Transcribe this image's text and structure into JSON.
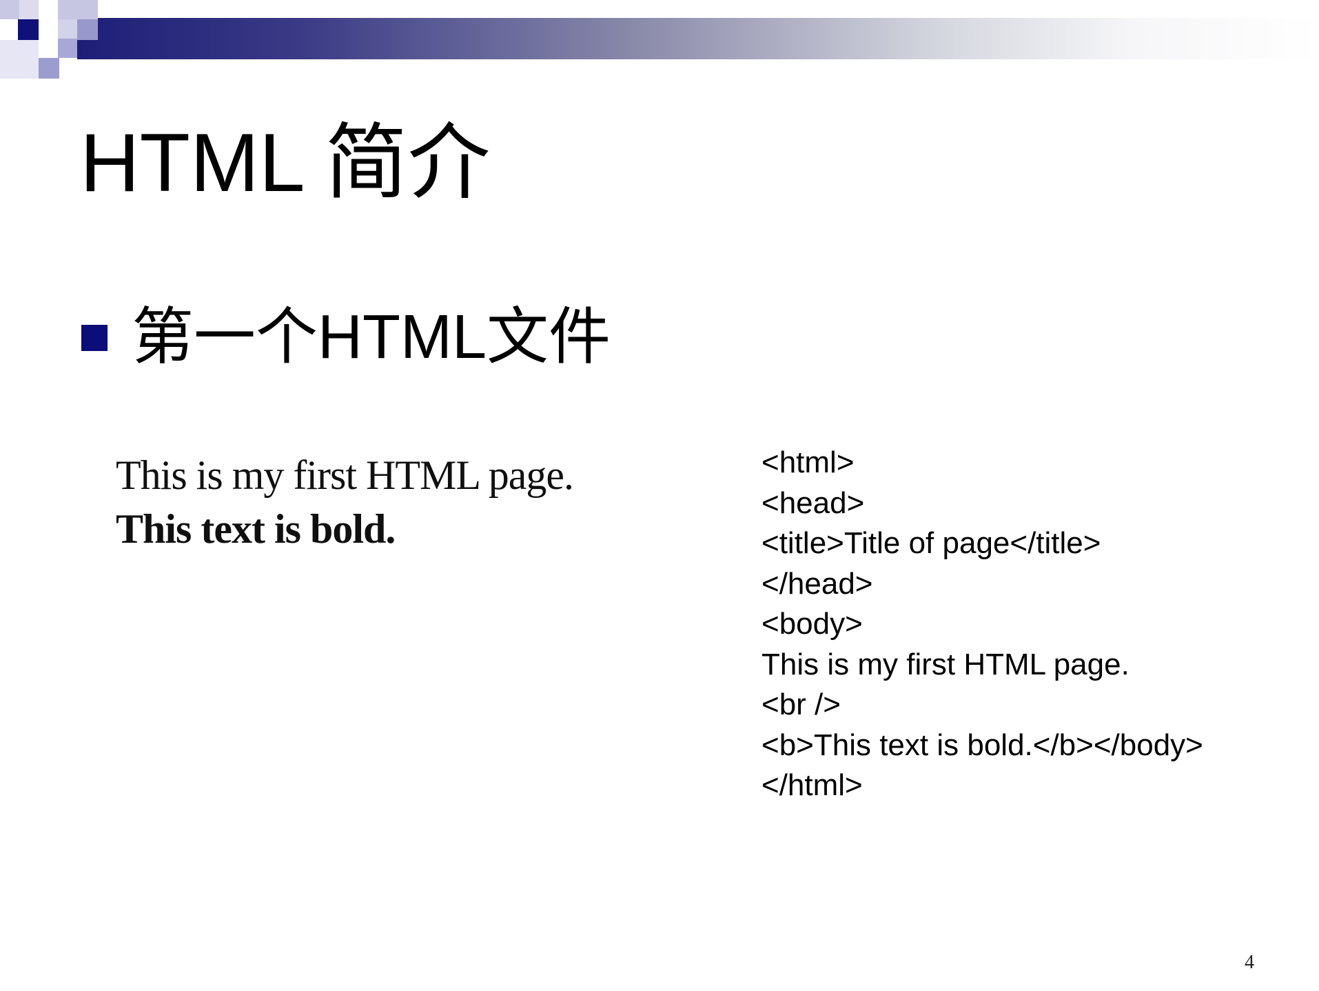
{
  "slide": {
    "title": "HTML 简介",
    "bullet": "第一个HTML文件",
    "rendered_preview": {
      "line1": "This is my first HTML page.",
      "line2": "This text is bold."
    },
    "code_lines": [
      "<html>",
      "<head>",
      "<title>Title of page</title>",
      "</head>",
      "<body>",
      "This is my first HTML page.",
      "<br />",
      "<b>This text is bold.</b></body>",
      "</html>"
    ],
    "page_number": "4"
  },
  "colors": {
    "accent": "#0c0c7a",
    "header_gradient_start": "#1e1e78"
  }
}
